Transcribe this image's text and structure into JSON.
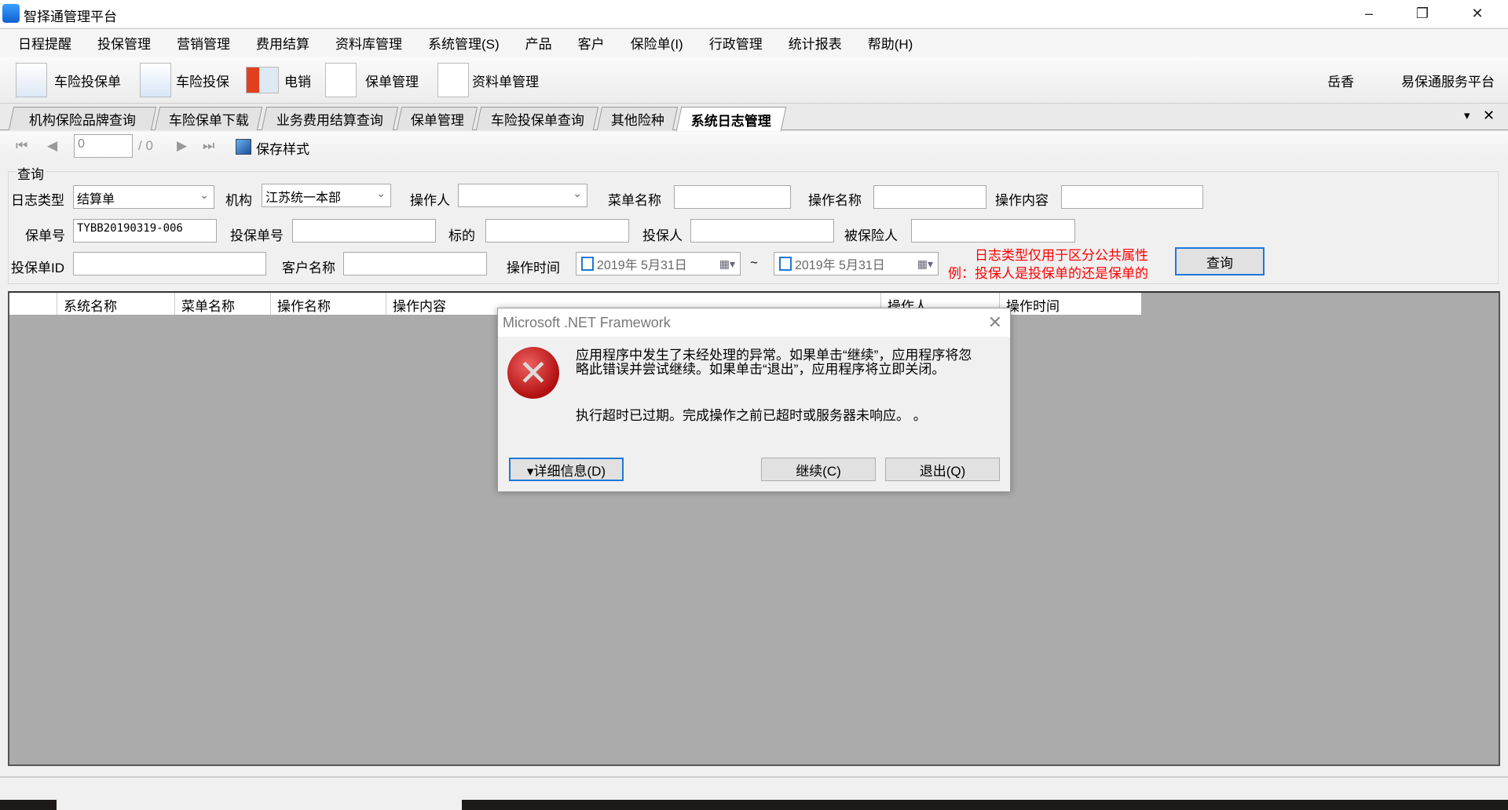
{
  "window": {
    "title": "智择通管理平台",
    "minimize": "–",
    "restore": "❐",
    "close": "✕"
  },
  "menu": [
    "日程提醒",
    "投保管理",
    "营销管理",
    "费用结算",
    "资料库管理",
    "系统管理(S)",
    "产品",
    "客户",
    "保险单(I)",
    "行政管理",
    "统计报表",
    "帮助(H)"
  ],
  "toolbar": {
    "items": [
      {
        "label": "车险投保单",
        "icon": "spreadsheet-icon"
      },
      {
        "label": "车险投保",
        "icon": "document-pen-icon"
      },
      {
        "label": "电销",
        "icon": "contact-card-icon"
      },
      {
        "label": "保单管理",
        "icon": "checklist-pen-icon"
      },
      {
        "label": "资料单管理",
        "icon": "blank-document-icon"
      }
    ],
    "user": "岳香",
    "platform": "易保通服务平台"
  },
  "tabs": [
    {
      "label": "机构保险品牌查询"
    },
    {
      "label": "车险保单下载"
    },
    {
      "label": "业务费用结算查询"
    },
    {
      "label": "保单管理"
    },
    {
      "label": "车险投保单查询"
    },
    {
      "label": "其他险种"
    },
    {
      "label": "系统日志管理",
      "active": true
    }
  ],
  "tabstrip": {
    "dropdown": "▾",
    "close": "✕"
  },
  "navigator": {
    "first": "⏮",
    "prev": "◀",
    "page": "0",
    "total": "/ 0",
    "next": "▶",
    "last": "⏭",
    "save_style": "保存样式"
  },
  "query": {
    "legend": "查询",
    "log_type_label": "日志类型",
    "log_type_value": "结算单",
    "org_label": "机构",
    "org_value": "江苏统一本部",
    "operator_label": "操作人",
    "operator_value": "",
    "menu_name_label": "菜单名称",
    "menu_name_value": "",
    "op_name_label": "操作名称",
    "op_name_value": "",
    "op_content_label": "操作内容",
    "op_content_value": "",
    "policy_no_label": "保单号",
    "policy_no_value": "TYBB20190319-006",
    "app_no_label": "投保单号",
    "app_no_value": "",
    "subject_label": "标的",
    "subject_value": "",
    "applicant_label": "投保人",
    "applicant_value": "",
    "insured_label": "被保险人",
    "insured_value": "",
    "app_id_label": "投保单ID",
    "app_id_value": "",
    "customer_label": "客户名称",
    "customer_value": "",
    "op_time_label": "操作时间",
    "date_from": "2019年 5月31日",
    "tilde": "~",
    "date_to": "2019年 5月31日",
    "note_line1": "日志类型仅用于区分公共属性",
    "note_line2": "例：投保人是投保单的还是保单的",
    "query_button": "查询"
  },
  "grid": {
    "columns": [
      "系统名称",
      "菜单名称",
      "操作名称",
      "操作内容",
      "操作人",
      "操作时间"
    ]
  },
  "dialog": {
    "title": "Microsoft .NET Framework",
    "close": "✕",
    "icon": "error-icon",
    "message": "应用程序中发生了未经处理的异常。如果单击“继续”，应用程序将忽略此错误并尝试继续。如果单击“退出”，应用程序将立即关闭。",
    "detail": "执行超时已过期。完成操作之前已超时或服务器未响应。 。",
    "details_button": "▾详细信息(D)",
    "continue_button": "继续(C)",
    "quit_button": "退出(Q)"
  }
}
